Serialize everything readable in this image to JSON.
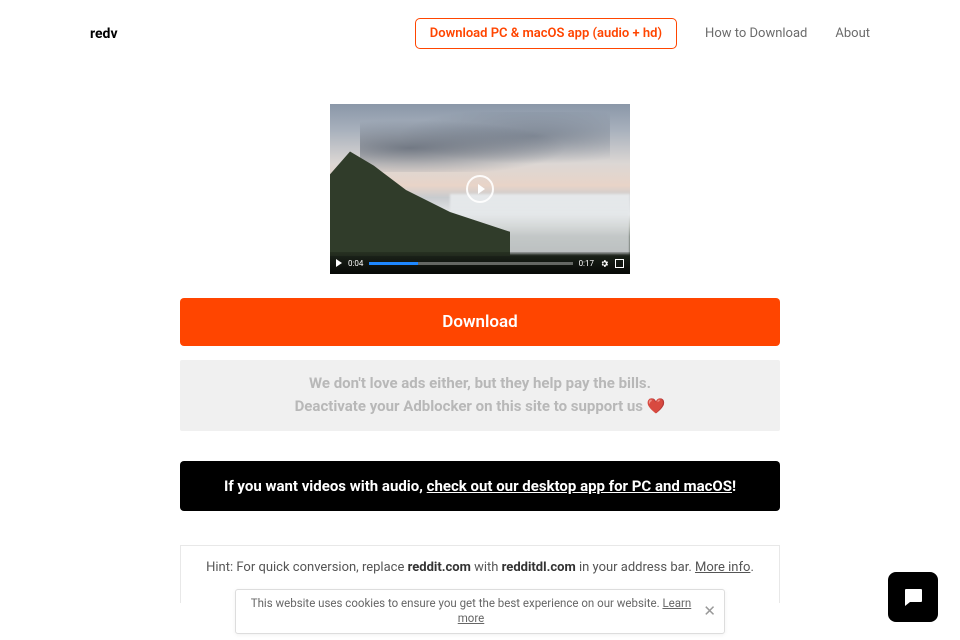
{
  "brand": "redv",
  "nav": {
    "download_app": "Download PC & macOS app (audio + hd)",
    "how_to": "How to Download",
    "about": "About"
  },
  "video": {
    "current_time": "0:04",
    "duration": "0:17",
    "progress_percent": 24
  },
  "download_button": "Download",
  "ads": {
    "line1": "We don't love ads either, but they help pay the bills.",
    "line2_prefix": "Deactivate your Adblocker on this site to support us ",
    "heart": "❤️"
  },
  "audio_promo": {
    "prefix": "If you want videos with audio, ",
    "link": "check out our desktop app for PC and macOS",
    "suffix": "!"
  },
  "hint": {
    "prefix": "Hint: For quick conversion, replace ",
    "from": "reddit.com",
    "mid": " with ",
    "to": "redditdl.com",
    "suffix": " in your address bar. ",
    "more": "More info",
    "dot": "."
  },
  "cookie": {
    "text": "This website uses cookies to ensure you get the best experience on our website. ",
    "learn": "Learn more"
  }
}
